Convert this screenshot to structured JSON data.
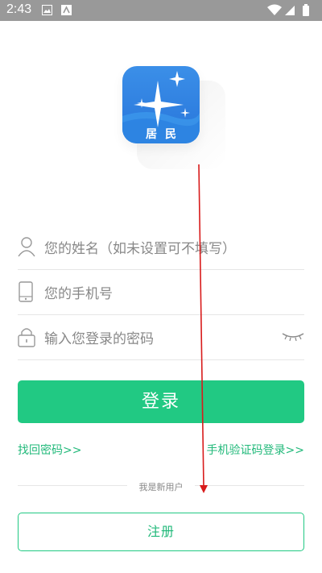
{
  "status_bar": {
    "time": "2:43"
  },
  "app": {
    "logo_label": "居民"
  },
  "form": {
    "name_placeholder": "您的姓名（如未设置可不填写）",
    "phone_placeholder": "您的手机号",
    "password_placeholder": "输入您登录的密码"
  },
  "actions": {
    "login_label": "登录",
    "forgot_password": "找回密码>>",
    "sms_login": "手机验证码登录>>",
    "new_user_divider": "我是新用户",
    "register_label": "注册"
  },
  "colors": {
    "accent": "#21c983",
    "status_bar": "#999999",
    "logo_blue": "#2f7fe0"
  }
}
